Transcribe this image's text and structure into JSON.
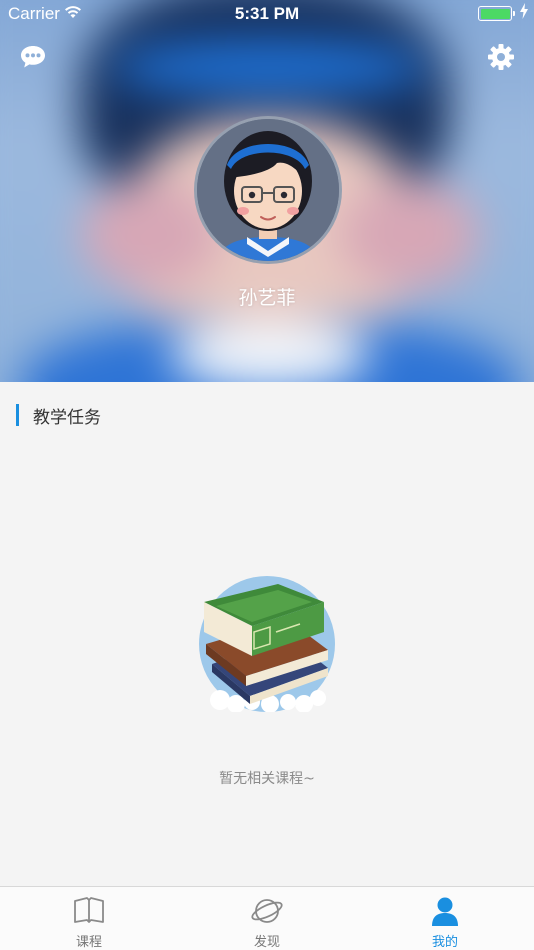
{
  "status_bar": {
    "carrier": "Carrier",
    "time": "5:31 PM",
    "battery_color": "#4cd964"
  },
  "header": {
    "message_icon": "chat-bubble-icon",
    "settings_icon": "gear-icon",
    "username": "孙艺菲"
  },
  "section": {
    "title": "教学任务",
    "accent_color": "#1a8fe0"
  },
  "empty_state": {
    "illustration": "book-stack-icon",
    "message": "暂无相关课程~"
  },
  "tabbar": {
    "active_color": "#1a8fe0",
    "tabs": [
      {
        "label": "课程",
        "icon": "book-open-icon",
        "active": false
      },
      {
        "label": "发现",
        "icon": "planet-icon",
        "active": false
      },
      {
        "label": "我的",
        "icon": "user-icon",
        "active": true
      }
    ]
  }
}
